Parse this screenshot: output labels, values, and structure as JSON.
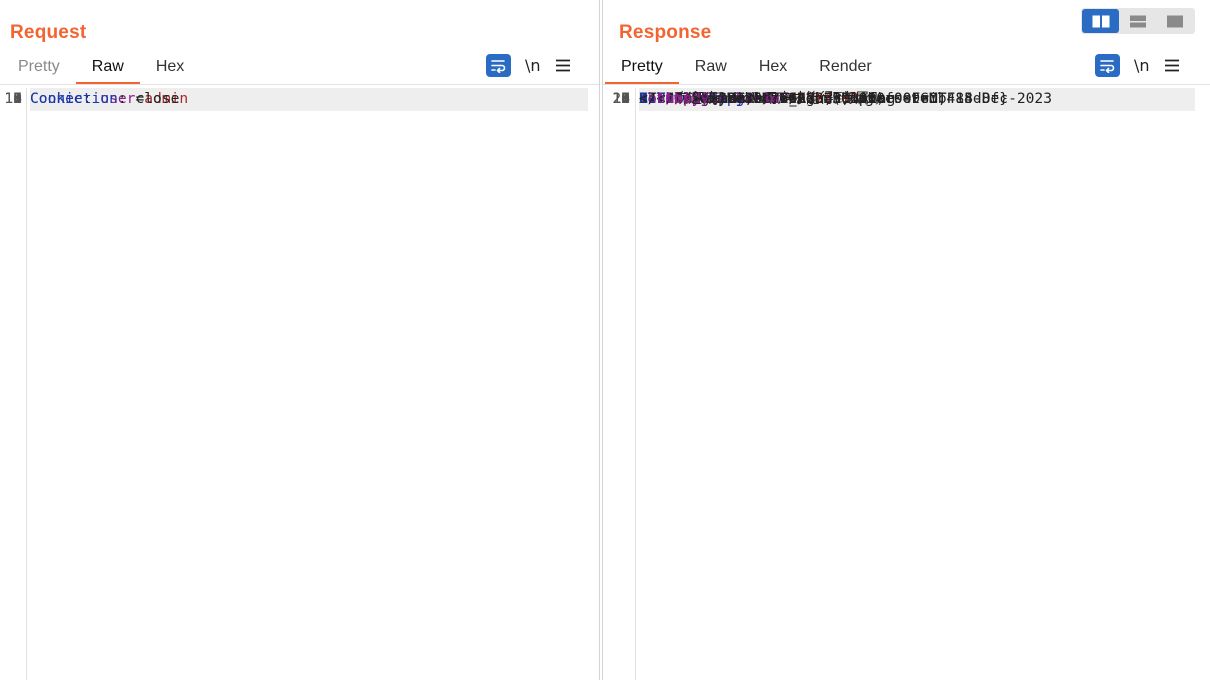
{
  "request": {
    "title": "Request",
    "tabs": [
      "Pretty",
      "Raw",
      "Hex"
    ],
    "active_tab": "Raw",
    "toolbar": {
      "newline_label": "\\n"
    },
    "lines": [
      {
        "n": "1",
        "text": "GET / HTTP/1.1"
      },
      {
        "n": "2",
        "name": "Host",
        "value": ""
      },
      {
        "n": "",
        "text": "cdd516ec-bf46-4f14-8d9c-666caf3fd4a8.www.polarctf.com:8"
      },
      {
        "n": "",
        "text": "090"
      },
      {
        "n": "3",
        "name": "Cache-Control",
        "value": "max-age=0"
      },
      {
        "n": "4",
        "name": "Upgrade-Insecure-Requests",
        "value": "1"
      },
      {
        "n": "5",
        "name": "User-Agent",
        "value": "Mozilla/5.0 (Windows NT 10.0; Win64; x64)"
      },
      {
        "n": "",
        "text": "AppleWebKit/537.36 (KHTML, like Gecko)"
      },
      {
        "n": "",
        "text": "Chrome/102.0.5005.63 Safari/537.36"
      },
      {
        "n": "6",
        "name": "Accept",
        "value": ""
      },
      {
        "n": "",
        "text": "text/html,application/xhtml+xml,application/xml;q=0.9,i"
      },
      {
        "n": "",
        "text": "mage/avif,image/webp,image/apng,*/*;q=0.8,application/s"
      },
      {
        "n": "",
        "text": "igned-exchange;v=b3;q=0.9"
      },
      {
        "n": "7",
        "name": "Accept-Encoding",
        "value": "gzip, deflate"
      },
      {
        "n": "8",
        "name": "Accept-Language",
        "value": "zh-CN,zh;q=0.9"
      },
      {
        "n": "9",
        "name": "Cookie",
        "cookie_name": "user",
        "cookie_value": "admin",
        "highlight": true
      },
      {
        "n": "10",
        "name": "Connection",
        "value": "close"
      },
      {
        "n": "11",
        "text": ""
      },
      {
        "n": "12",
        "text": ""
      }
    ]
  },
  "response": {
    "title": "Response",
    "tabs": [
      "Pretty",
      "Raw",
      "Hex",
      "Render"
    ],
    "active_tab": "Pretty",
    "toolbar": {
      "newline_label": "\\n"
    },
    "layout_modes": [
      "side-by-side",
      "stacked",
      "single"
    ],
    "active_layout": "side-by-side",
    "lines": [
      {
        "n": "1",
        "text": "HTTP/1.1 200 OK",
        "highlight": true
      },
      {
        "n": "2",
        "name": "Content-Length",
        "value": "222"
      },
      {
        "n": "3",
        "name": "Content-Type",
        "value": "text/html; charset=UTF-8"
      },
      {
        "n": "4",
        "name": "Date",
        "value": "Mon, 11 Dec 2023 10:10:00 GMT"
      },
      {
        "n": "5",
        "name": "Server",
        "value": "Apache/2.4.23 (Unix)"
      },
      {
        "n": "6",
        "name": "Set-Cookie",
        "cookie_name": "user",
        "cookie_value": "user",
        "rest": "; expires=Fri, 15-Dec-2023"
      },
      {
        "n": "",
        "text": "14:10:00 GMT; Max-Age=360000"
      },
      {
        "n": "7",
        "name": "X-Powered-By",
        "value": "PHP/7.0.9"
      },
      {
        "n": "8",
        "name": "Connection",
        "value": "close"
      },
      {
        "n": "9",
        "text": ""
      },
      {
        "n": "10",
        "text": ""
      },
      {
        "n": "11",
        "indent": 0,
        "open": "html"
      },
      {
        "n": "12",
        "indent": 1,
        "open": "head"
      },
      {
        "n": "13",
        "indent": 2,
        "open": "meta",
        "attr": "charset",
        "attr_value": "\"utf-8\""
      },
      {
        "n": "14",
        "indent": 2,
        "open": "title"
      },
      {
        "n": "",
        "indent": 3,
        "text": "PolarD&N CTF_Admin专属flag"
      },
      {
        "n": "",
        "indent": 2,
        "close": "title"
      },
      {
        "n": "15",
        "indent": 1,
        "close": "head"
      },
      {
        "n": "16",
        "indent": 1,
        "open": "body"
      },
      {
        "n": "17",
        "indent": 2,
        "open": "p"
      },
      {
        "n": "",
        "indent": 3,
        "text": "只有admin用户才能得到flag，"
      },
      {
        "n": "",
        "indent": 2,
        "close": "p"
      },
      {
        "n": "18",
        "indent": 2,
        "text": "欢迎 admin!",
        "open_after": "br"
      },
      {
        "n": "",
        "indent": 2,
        "text": "flag{10e35c76602b330149ef009e0b484d8f}"
      },
      {
        "n": "19",
        "indent": 1,
        "close": "body"
      },
      {
        "n": "20",
        "indent": 0,
        "close": "html"
      }
    ]
  },
  "colors": {
    "accent_orange": "#f26430",
    "header_name_blue": "#1a36a8",
    "tag_purple": "#8e1f8e",
    "cookie_value_red": "#a52a2a",
    "button_blue": "#2a6cc4"
  }
}
